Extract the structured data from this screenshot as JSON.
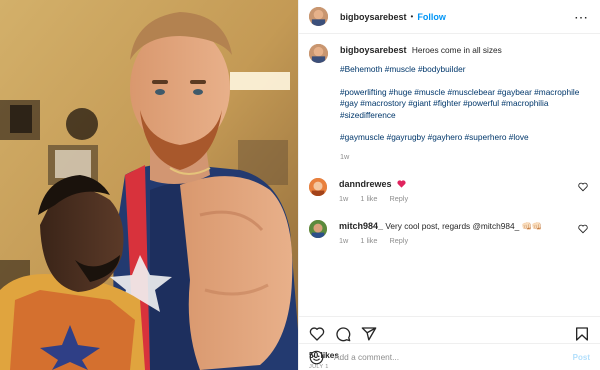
{
  "post": {
    "username": "bigboysarebest",
    "follow_label": "Follow",
    "more_icon": "more-options-icon",
    "caption": {
      "text": "Heroes come in all sizes",
      "tag_lines": [
        "#Behemoth #muscle #bodybuilder",
        "#powerlifting #huge #muscle #musclebear #gaybear #macrophile #gay #macrostory  #giant #fighter #powerful #macrophilia #sizedifference",
        "#gaymuscle #gayrugby #gayhero #superhero #love"
      ],
      "time": "1w"
    },
    "comments": [
      {
        "username": "danndrewes",
        "text": "",
        "time": "1w",
        "likes": "1 like",
        "reply": "Reply",
        "emoji": "red-heart"
      },
      {
        "username": "mitch984_",
        "text": "Very cool post, regards @mitch984_ 👊🏻👊🏻",
        "time": "1w",
        "likes": "1 like",
        "reply": "Reply"
      }
    ],
    "likes": "50 likes",
    "date": "JULY 1",
    "add_comment": {
      "placeholder": "Add a comment...",
      "post_label": "Post"
    },
    "icons": [
      "heart-icon",
      "comment-icon",
      "share-icon",
      "bookmark-icon",
      "emoji-icon"
    ]
  },
  "colors": {
    "link": "#00376b",
    "follow": "#0095f6",
    "muted": "#8e8e8e",
    "post_disabled": "#b2dffc"
  }
}
